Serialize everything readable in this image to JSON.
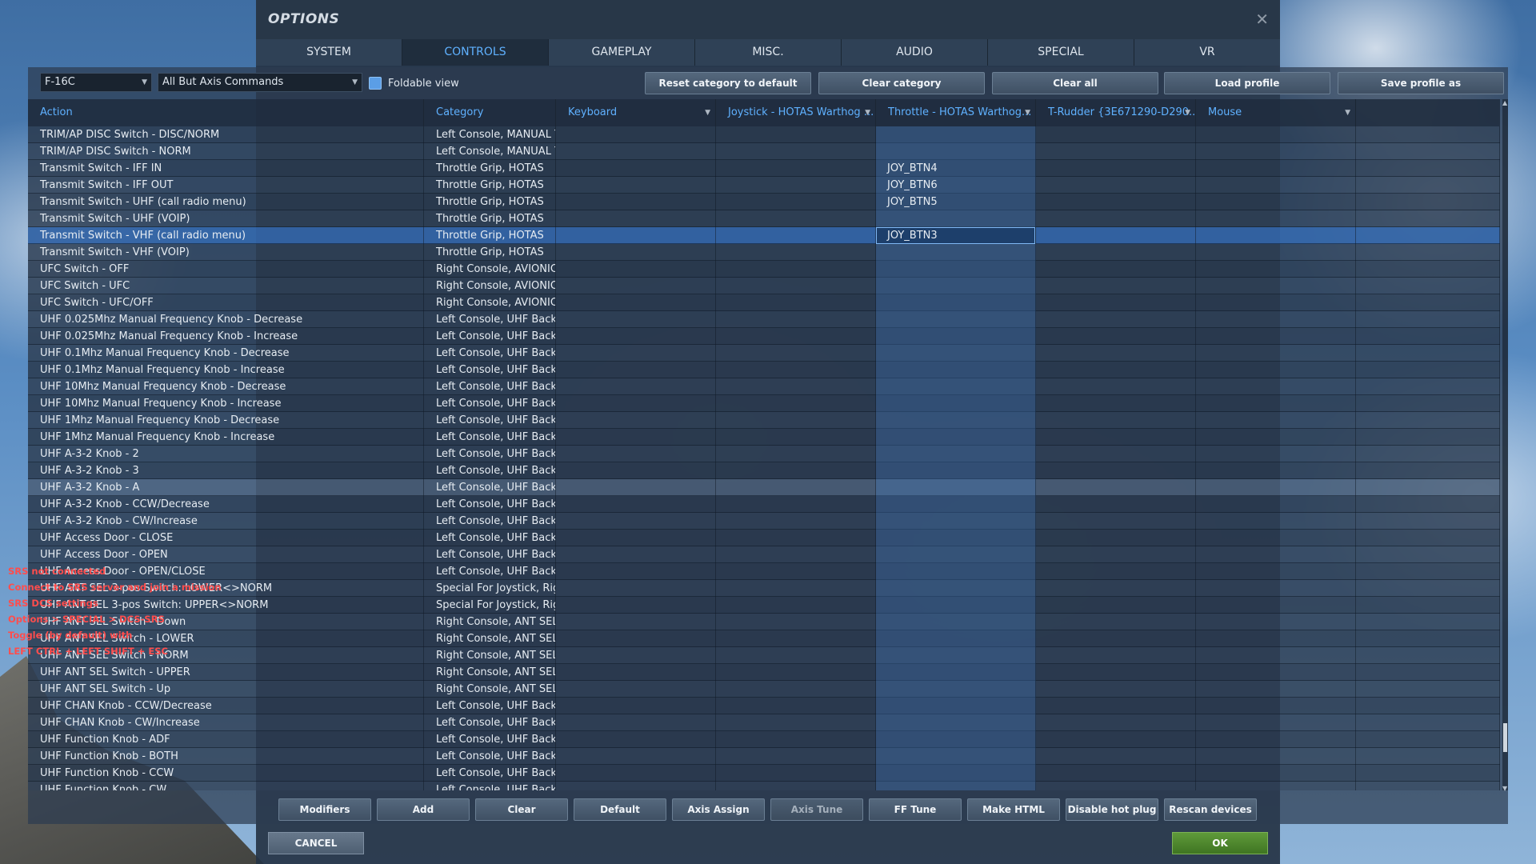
{
  "window": {
    "title": "OPTIONS",
    "close_glyph": "✕",
    "tabs": [
      {
        "label": "SYSTEM"
      },
      {
        "label": "CONTROLS",
        "active": true
      },
      {
        "label": "GAMEPLAY"
      },
      {
        "label": "MISC."
      },
      {
        "label": "AUDIO"
      },
      {
        "label": "SPECIAL"
      },
      {
        "label": "VR"
      }
    ]
  },
  "toolbar": {
    "aircraft_select": "F-16C",
    "filter_select": "All But Axis Commands",
    "foldable_view_label": "Foldable view",
    "foldable_view_checked": true,
    "buttons": {
      "reset_category": "Reset category to default",
      "clear_category": "Clear category",
      "clear_all": "Clear all",
      "load_profile": "Load profile",
      "save_profile_as": "Save profile as"
    }
  },
  "table": {
    "headers": {
      "action": "Action",
      "category": "Category",
      "keyboard": "Keyboard",
      "joystick": "Joystick - HOTAS Warthog ...",
      "throttle": "Throttle - HOTAS Warthog...",
      "trudder": "T-Rudder {3E671290-D290...",
      "mouse": "Mouse"
    },
    "rows": [
      {
        "action": "TRIM/AP DISC Switch - DISC/NORM",
        "category": "Left Console, MANUAL TR",
        "throttle": ""
      },
      {
        "action": "TRIM/AP DISC Switch - NORM",
        "category": "Left Console, MANUAL TR",
        "throttle": ""
      },
      {
        "action": "Transmit Switch - IFF IN",
        "category": "Throttle Grip, HOTAS",
        "throttle": "JOY_BTN4"
      },
      {
        "action": "Transmit Switch - IFF OUT",
        "category": "Throttle Grip, HOTAS",
        "throttle": "JOY_BTN6"
      },
      {
        "action": "Transmit Switch - UHF (call radio menu)",
        "category": "Throttle Grip, HOTAS",
        "throttle": "JOY_BTN5"
      },
      {
        "action": "Transmit Switch - UHF (VOIP)",
        "category": "Throttle Grip, HOTAS",
        "throttle": ""
      },
      {
        "action": "Transmit Switch - VHF (call radio menu)",
        "category": "Throttle Grip, HOTAS",
        "throttle": "JOY_BTN3",
        "selected": true
      },
      {
        "action": "Transmit Switch - VHF (VOIP)",
        "category": "Throttle Grip, HOTAS",
        "throttle": ""
      },
      {
        "action": "UFC Switch - OFF",
        "category": "Right Console, AVIONICS F",
        "throttle": ""
      },
      {
        "action": "UFC Switch - UFC",
        "category": "Right Console, AVIONICS F",
        "throttle": ""
      },
      {
        "action": "UFC Switch - UFC/OFF",
        "category": "Right Console, AVIONICS F",
        "throttle": ""
      },
      {
        "action": "UHF 0.025Mhz Manual Frequency Knob - Decrease",
        "category": "Left Console, UHF Backup",
        "throttle": ""
      },
      {
        "action": "UHF 0.025Mhz Manual Frequency Knob - Increase",
        "category": "Left Console, UHF Backup",
        "throttle": ""
      },
      {
        "action": "UHF 0.1Mhz Manual Frequency Knob - Decrease",
        "category": "Left Console, UHF Backup",
        "throttle": ""
      },
      {
        "action": "UHF 0.1Mhz Manual Frequency Knob - Increase",
        "category": "Left Console, UHF Backup",
        "throttle": ""
      },
      {
        "action": "UHF 10Mhz Manual Frequency Knob - Decrease",
        "category": "Left Console, UHF Backup",
        "throttle": ""
      },
      {
        "action": "UHF 10Mhz Manual Frequency Knob - Increase",
        "category": "Left Console, UHF Backup",
        "throttle": ""
      },
      {
        "action": "UHF 1Mhz Manual Frequency Knob - Decrease",
        "category": "Left Console, UHF Backup",
        "throttle": ""
      },
      {
        "action": "UHF 1Mhz Manual Frequency Knob - Increase",
        "category": "Left Console, UHF Backup",
        "throttle": ""
      },
      {
        "action": "UHF A-3-2 Knob - 2",
        "category": "Left Console, UHF Backup",
        "throttle": ""
      },
      {
        "action": "UHF A-3-2 Knob - 3",
        "category": "Left Console, UHF Backup",
        "throttle": ""
      },
      {
        "action": "UHF A-3-2 Knob - A",
        "category": "Left Console, UHF Backup",
        "throttle": "",
        "hover": true
      },
      {
        "action": "UHF A-3-2 Knob - CCW/Decrease",
        "category": "Left Console, UHF Backup",
        "throttle": ""
      },
      {
        "action": "UHF A-3-2 Knob - CW/Increase",
        "category": "Left Console, UHF Backup",
        "throttle": ""
      },
      {
        "action": "UHF Access Door - CLOSE",
        "category": "Left Console, UHF Backup",
        "throttle": ""
      },
      {
        "action": "UHF Access Door - OPEN",
        "category": "Left Console, UHF Backup",
        "throttle": ""
      },
      {
        "action": "UHF Access Door - OPEN/CLOSE",
        "category": "Left Console, UHF Backup",
        "throttle": ""
      },
      {
        "action": "UHF ANT SEL 3-pos Switch: LOWER<>NORM",
        "category": "Special For Joystick, Right",
        "throttle": ""
      },
      {
        "action": "UHF ANT SEL 3-pos Switch: UPPER<>NORM",
        "category": "Special For Joystick, Right",
        "throttle": ""
      },
      {
        "action": "UHF ANT SEL Switch - Down",
        "category": "Right Console, ANT SEL Pa",
        "throttle": ""
      },
      {
        "action": "UHF ANT SEL Switch - LOWER",
        "category": "Right Console, ANT SEL Pa",
        "throttle": ""
      },
      {
        "action": "UHF ANT SEL Switch - NORM",
        "category": "Right Console, ANT SEL Pa",
        "throttle": ""
      },
      {
        "action": "UHF ANT SEL Switch - UPPER",
        "category": "Right Console, ANT SEL Pa",
        "throttle": ""
      },
      {
        "action": "UHF ANT SEL Switch - Up",
        "category": "Right Console, ANT SEL Pa",
        "throttle": ""
      },
      {
        "action": "UHF CHAN Knob - CCW/Decrease",
        "category": "Left Console, UHF Backup",
        "throttle": ""
      },
      {
        "action": "UHF CHAN Knob - CW/Increase",
        "category": "Left Console, UHF Backup",
        "throttle": ""
      },
      {
        "action": "UHF Function Knob - ADF",
        "category": "Left Console, UHF Backup",
        "throttle": ""
      },
      {
        "action": "UHF Function Knob - BOTH",
        "category": "Left Console, UHF Backup",
        "throttle": ""
      },
      {
        "action": "UHF Function Knob - CCW",
        "category": "Left Console, UHF Backup",
        "throttle": ""
      },
      {
        "action": "UHF Function Knob - CW",
        "category": "Left Console, UHF Backup",
        "throttle": ""
      }
    ]
  },
  "bottom_buttons": {
    "modifiers": "Modifiers",
    "add": "Add",
    "clear": "Clear",
    "default": "Default",
    "axis_assign": "Axis Assign",
    "axis_tune": "Axis Tune",
    "ff_tune": "FF Tune",
    "make_html": "Make HTML",
    "disable_hot_plug": "Disable hot plug",
    "rescan_devices": "Rescan devices"
  },
  "dialog": {
    "cancel": "CANCEL",
    "ok": "OK"
  },
  "srs_overlay": [
    "SRS not connected",
    "Connect to SRS server and join a mission",
    "SRS DCS settings",
    "Options > SPECIAL > DCS-SRS",
    "Toggle (by default) with",
    "LEFT CTRL + LEFT SHIFT + ESC"
  ],
  "colors": {
    "accent_blue": "#5fb1ff",
    "selected_row": "#346cb4",
    "ok_green": "#4f8a2d",
    "srs_red": "#ff4d4d"
  }
}
